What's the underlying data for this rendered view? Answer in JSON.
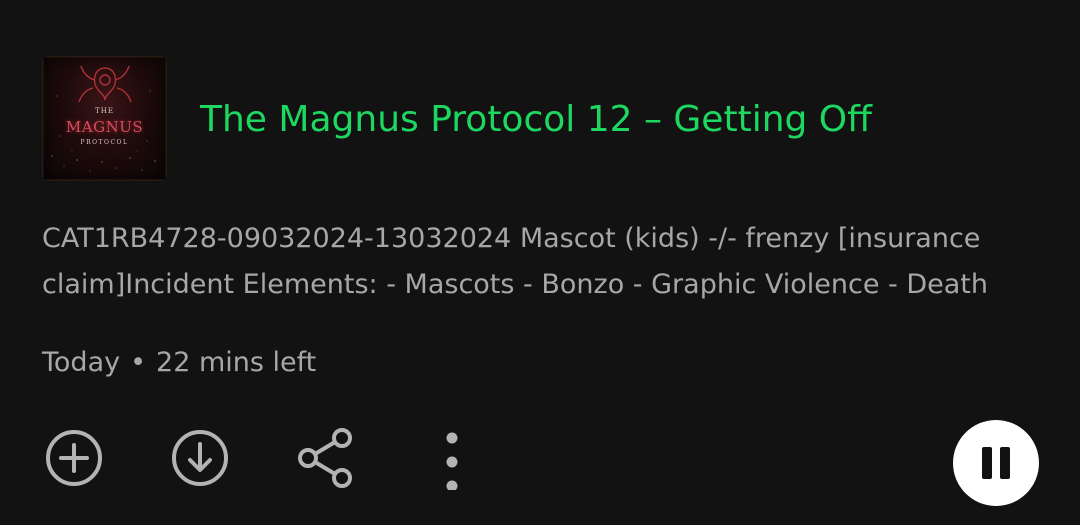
{
  "episode": {
    "title": "The Magnus Protocol 12 – Getting Off",
    "description": "CAT1RB4728-09032024-13032024 Mascot (kids) -/- frenzy [insurance claim]Incident Elements: - Mascots - Bonzo - Graphic Violence - Death",
    "date": "Today",
    "separator": "•",
    "remaining": "22 mins left"
  },
  "cover": {
    "the": "THE",
    "name": "MAGNUS",
    "subtitle": "PROTOCOL"
  },
  "actions": {
    "add_icon": "plus-circle-icon",
    "download_icon": "download-circle-icon",
    "share_icon": "share-icon",
    "more_icon": "more-vertical-icon",
    "play_state_icon": "pause-icon"
  },
  "colors": {
    "background": "#121212",
    "title": "#1ed760",
    "secondary_text": "#a7a7a7",
    "icon": "#b3b3b3",
    "play_button": "#ffffff"
  }
}
